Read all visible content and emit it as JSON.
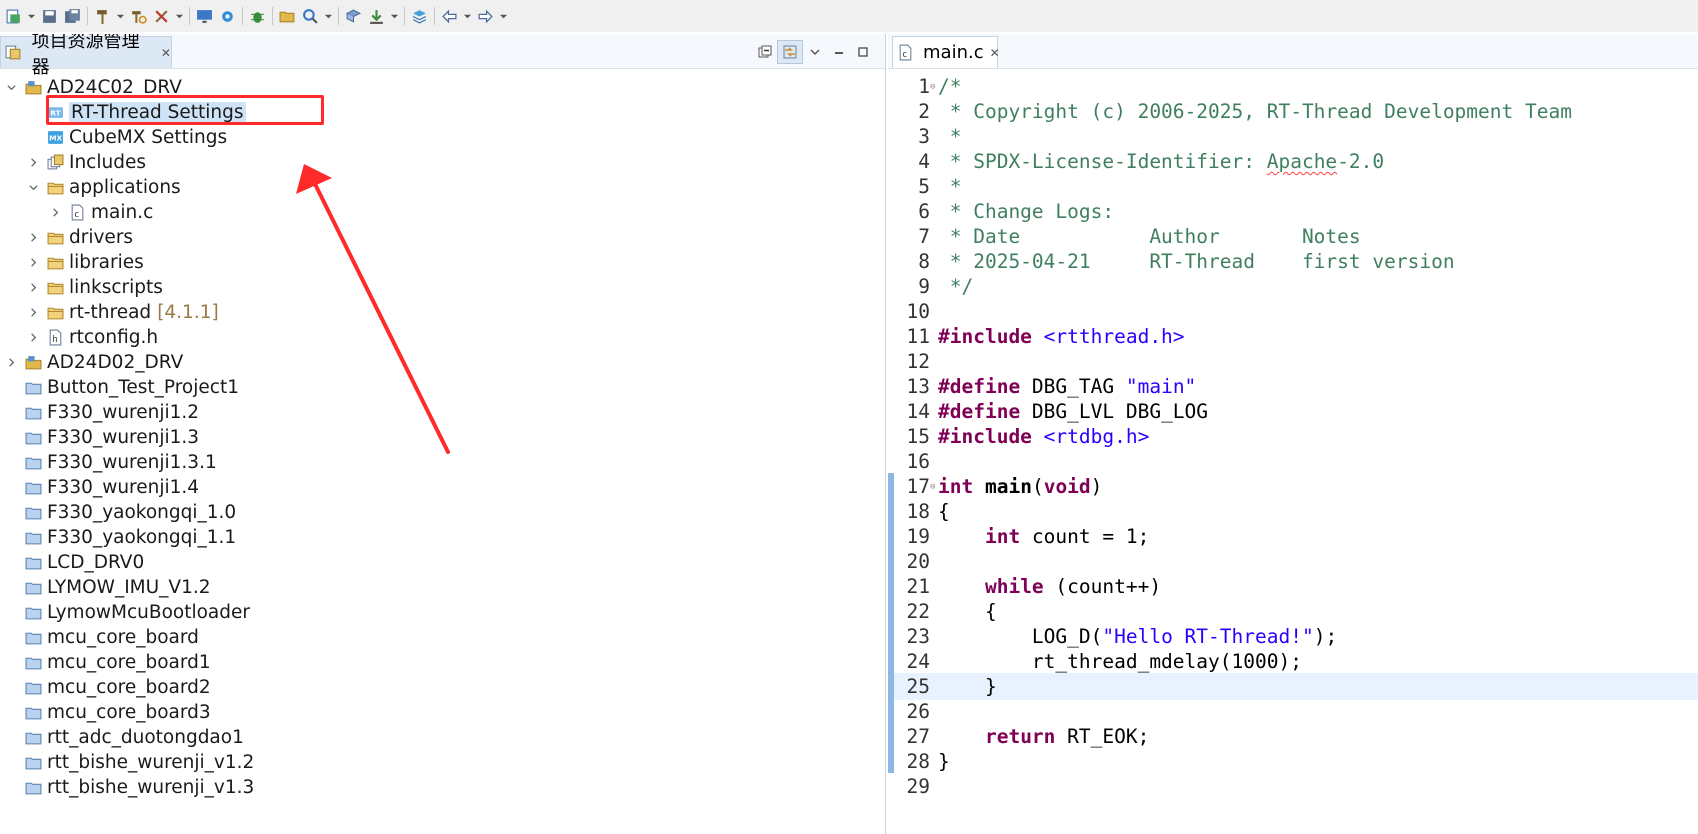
{
  "toolbar": {
    "icons": [
      "new-icon",
      "dropdown",
      "save-icon",
      "save-all-icon",
      "hammer-build-icon",
      "dropdown",
      "rebuild-icon",
      "clean-icon",
      "dropdown",
      "monitor-icon",
      "gear-icon",
      "debug-bug-icon",
      "open-folder-icon",
      "search-icon",
      "dropdown",
      "book-icon",
      "download-icon",
      "dropdown",
      "layers-icon",
      "back-arrow-icon",
      "dropdown",
      "forward-arrow-icon",
      "dropdown"
    ]
  },
  "explorer": {
    "tab_title": "项目资源管理器",
    "close_glyph": "✕",
    "tree": [
      {
        "label": "AD24C02_DRV",
        "level": 0,
        "expander": "expanded",
        "icon": "project-icon"
      },
      {
        "label": "RT-Thread Settings",
        "level": 1,
        "expander": "none",
        "icon": "rt-settings-icon",
        "selected": true
      },
      {
        "label": "CubeMX Settings",
        "level": 1,
        "expander": "none",
        "icon": "cubemx-icon"
      },
      {
        "label": "Includes",
        "level": 1,
        "expander": "collapsed",
        "icon": "includes-icon"
      },
      {
        "label": "applications",
        "level": 1,
        "expander": "expanded",
        "icon": "folder-icon"
      },
      {
        "label": "main.c",
        "level": 2,
        "expander": "collapsed",
        "icon": "c-file-icon"
      },
      {
        "label": "drivers",
        "level": 1,
        "expander": "collapsed",
        "icon": "folder-icon"
      },
      {
        "label": "libraries",
        "level": 1,
        "expander": "collapsed",
        "icon": "folder-icon"
      },
      {
        "label": "linkscripts",
        "level": 1,
        "expander": "collapsed",
        "icon": "folder-icon"
      },
      {
        "label": "rt-thread",
        "level": 1,
        "expander": "collapsed",
        "icon": "folder-icon",
        "version": "[4.1.1]"
      },
      {
        "label": "rtconfig.h",
        "level": 1,
        "expander": "collapsed",
        "icon": "h-file-icon"
      },
      {
        "label": "AD24D02_DRV",
        "level": 0,
        "expander": "collapsed",
        "icon": "project-icon"
      },
      {
        "label": "Button_Test_Project1",
        "level": 0,
        "expander": "none",
        "icon": "closed-project-icon"
      },
      {
        "label": "F330_wurenji1.2",
        "level": 0,
        "expander": "none",
        "icon": "closed-project-icon"
      },
      {
        "label": "F330_wurenji1.3",
        "level": 0,
        "expander": "none",
        "icon": "closed-project-icon"
      },
      {
        "label": "F330_wurenji1.3.1",
        "level": 0,
        "expander": "none",
        "icon": "closed-project-icon"
      },
      {
        "label": "F330_wurenji1.4",
        "level": 0,
        "expander": "none",
        "icon": "closed-project-icon"
      },
      {
        "label": "F330_yaokongqi_1.0",
        "level": 0,
        "expander": "none",
        "icon": "closed-project-icon"
      },
      {
        "label": "F330_yaokongqi_1.1",
        "level": 0,
        "expander": "none",
        "icon": "closed-project-icon"
      },
      {
        "label": "LCD_DRV0",
        "level": 0,
        "expander": "none",
        "icon": "closed-project-icon"
      },
      {
        "label": "LYMOW_IMU_V1.2",
        "level": 0,
        "expander": "none",
        "icon": "closed-project-icon"
      },
      {
        "label": "LymowMcuBootloader",
        "level": 0,
        "expander": "none",
        "icon": "closed-project-icon"
      },
      {
        "label": "mcu_core_board",
        "level": 0,
        "expander": "none",
        "icon": "closed-project-icon"
      },
      {
        "label": "mcu_core_board1",
        "level": 0,
        "expander": "none",
        "icon": "closed-project-icon"
      },
      {
        "label": "mcu_core_board2",
        "level": 0,
        "expander": "none",
        "icon": "closed-project-icon"
      },
      {
        "label": "mcu_core_board3",
        "level": 0,
        "expander": "none",
        "icon": "closed-project-icon"
      },
      {
        "label": "rtt_adc_duotongdao1",
        "level": 0,
        "expander": "none",
        "icon": "closed-project-icon"
      },
      {
        "label": "rtt_bishe_wurenji_v1.2",
        "level": 0,
        "expander": "none",
        "icon": "closed-project-icon"
      },
      {
        "label": "rtt_bishe_wurenji_v1.3",
        "level": 0,
        "expander": "none",
        "icon": "closed-project-icon"
      }
    ]
  },
  "editor": {
    "tab_title": "main.c",
    "close_glyph": "✕",
    "current_line": 25,
    "lines": [
      {
        "n": "1",
        "fold": "⊖",
        "tokens": [
          [
            "cm",
            "/*"
          ]
        ]
      },
      {
        "n": "2",
        "tokens": [
          [
            "cm",
            " * Copyright (c) 2006-2025, RT-Thread Development Team"
          ]
        ]
      },
      {
        "n": "3",
        "tokens": [
          [
            "cm",
            " *"
          ]
        ]
      },
      {
        "n": "4",
        "tokens": [
          [
            "cm",
            " * SPDX-License-Identifier: "
          ],
          [
            "cm sq",
            "Apache"
          ],
          [
            "cm",
            "-2.0"
          ]
        ]
      },
      {
        "n": "5",
        "tokens": [
          [
            "cm",
            " *"
          ]
        ]
      },
      {
        "n": "6",
        "tokens": [
          [
            "cm",
            " * Change Logs:"
          ]
        ]
      },
      {
        "n": "7",
        "tokens": [
          [
            "cm",
            " * Date           Author       Notes"
          ]
        ]
      },
      {
        "n": "8",
        "tokens": [
          [
            "cm",
            " * 2025-04-21     RT-Thread    first version"
          ]
        ]
      },
      {
        "n": "9",
        "tokens": [
          [
            "cm",
            " */"
          ]
        ]
      },
      {
        "n": "10",
        "tokens": []
      },
      {
        "n": "11",
        "tokens": [
          [
            "kw",
            "#include"
          ],
          [
            "",
            ""
          ],
          [
            "",
            ""
          ],
          [
            "inc",
            " <rtthread.h>"
          ]
        ]
      },
      {
        "n": "12",
        "tokens": []
      },
      {
        "n": "13",
        "tokens": [
          [
            "kw",
            "#define"
          ],
          [
            "",
            " DBG_TAG "
          ],
          [
            "str",
            "\"main\""
          ]
        ]
      },
      {
        "n": "14",
        "tokens": [
          [
            "kw",
            "#define"
          ],
          [
            "",
            " DBG_LVL DBG_LOG"
          ]
        ]
      },
      {
        "n": "15",
        "tokens": [
          [
            "kw",
            "#include"
          ],
          [
            "inc",
            " <rtdbg.h>"
          ]
        ]
      },
      {
        "n": "16",
        "tokens": []
      },
      {
        "n": "17",
        "fold": "⊖",
        "tokens": [
          [
            "kw",
            "int"
          ],
          [
            "",
            " "
          ],
          [
            "fn",
            "main"
          ],
          [
            "",
            "("
          ],
          [
            "kw",
            "void"
          ],
          [
            "",
            ")"
          ]
        ]
      },
      {
        "n": "18",
        "tokens": [
          [
            "",
            "{"
          ]
        ]
      },
      {
        "n": "19",
        "tokens": [
          [
            "",
            "    "
          ],
          [
            "kw",
            "int"
          ],
          [
            "",
            " count = 1;"
          ]
        ]
      },
      {
        "n": "20",
        "tokens": []
      },
      {
        "n": "21",
        "tokens": [
          [
            "",
            "    "
          ],
          [
            "kw",
            "while"
          ],
          [
            "",
            " (count++)"
          ]
        ]
      },
      {
        "n": "22",
        "tokens": [
          [
            "",
            "    {"
          ]
        ]
      },
      {
        "n": "23",
        "tokens": [
          [
            "",
            "        LOG_D("
          ],
          [
            "str",
            "\"Hello RT-Thread!\""
          ],
          [
            "",
            ");"
          ]
        ]
      },
      {
        "n": "24",
        "tokens": [
          [
            "",
            "        rt_thread_mdelay(1000);"
          ]
        ]
      },
      {
        "n": "25",
        "tokens": [
          [
            "",
            "    }"
          ]
        ]
      },
      {
        "n": "26",
        "tokens": []
      },
      {
        "n": "27",
        "tokens": [
          [
            "",
            "    "
          ],
          [
            "kw",
            "return"
          ],
          [
            "",
            " RT_EOK;"
          ]
        ]
      },
      {
        "n": "28",
        "tokens": [
          [
            "",
            "}"
          ]
        ]
      },
      {
        "n": "29",
        "tokens": []
      }
    ]
  },
  "colors": {
    "annotation": "#ff2a2a",
    "comment": "#3f7f5f",
    "keyword": "#7f0055",
    "string": "#2a00ff"
  }
}
